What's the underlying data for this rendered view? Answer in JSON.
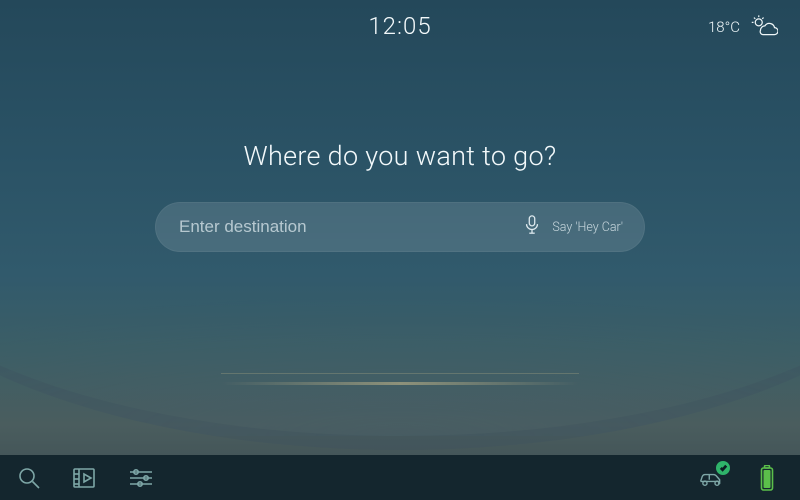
{
  "status": {
    "time": "12:05",
    "temperature": "18°C",
    "weather_icon": "partly-cloudy"
  },
  "hero": {
    "title": "Where do you want to go?"
  },
  "search": {
    "value": "",
    "placeholder": "Enter destination",
    "voice_hint": "Say 'Hey Car'"
  },
  "bottombar": {
    "left_icons": [
      "search",
      "media",
      "settings-sliders"
    ],
    "right_icons": [
      "car-status",
      "battery"
    ],
    "car_status_ok": true
  },
  "colors": {
    "accent_teal": "#7ea7a7",
    "ok_green": "#2fb36a",
    "battery_green": "#5bbf4a",
    "bar_bg": "#14262e"
  }
}
